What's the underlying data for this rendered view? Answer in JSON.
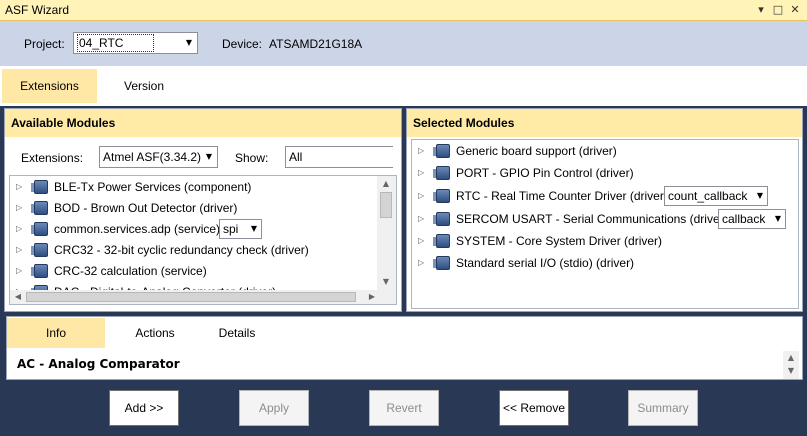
{
  "window": {
    "title": "ASF Wizard",
    "controls": [
      "▾",
      "□",
      "✕"
    ]
  },
  "toolbar": {
    "project_label": "Project:",
    "project_value": "04_RTC",
    "device_label": "Device:",
    "device_value": "ATSAMD21G18A"
  },
  "top_tabs": [
    {
      "label": "Extensions",
      "active": true
    },
    {
      "label": "Version",
      "active": false
    }
  ],
  "available": {
    "header": "Available Modules",
    "extensions_label": "Extensions:",
    "extensions_value": "Atmel ASF(3.34.2)",
    "show_label": "Show:",
    "show_value": "All",
    "items": [
      {
        "label": "BLE-Tx Power Services (component)"
      },
      {
        "label": "BOD - Brown Out Detector (driver)"
      },
      {
        "label": "common.services.adp (service)",
        "option": "spi"
      },
      {
        "label": "CRC32 - 32-bit cyclic redundancy check (driver)"
      },
      {
        "label": "CRC-32 calculation (service)"
      },
      {
        "label": "DAC - Digital-to-Analog Converter (driver)"
      }
    ]
  },
  "selected": {
    "header": "Selected Modules",
    "items": [
      {
        "label": "Generic board support (driver)"
      },
      {
        "label": "PORT - GPIO Pin Control (driver)"
      },
      {
        "label": "RTC - Real Time Counter Driver (driver)",
        "option": "count_callback"
      },
      {
        "label": "SERCOM USART - Serial Communications (driver)",
        "option": "callback"
      },
      {
        "label": "SYSTEM - Core System Driver (driver)"
      },
      {
        "label": "Standard serial I/O (stdio) (driver)"
      }
    ]
  },
  "info": {
    "tabs": [
      {
        "label": "Info",
        "active": true
      },
      {
        "label": "Actions",
        "active": false
      },
      {
        "label": "Details",
        "active": false
      }
    ],
    "heading": "AC - Analog Comparator"
  },
  "buttons": {
    "add": "Add >>",
    "apply": "Apply",
    "revert": "Revert",
    "remove": "<< Remove",
    "summary": "Summary"
  }
}
